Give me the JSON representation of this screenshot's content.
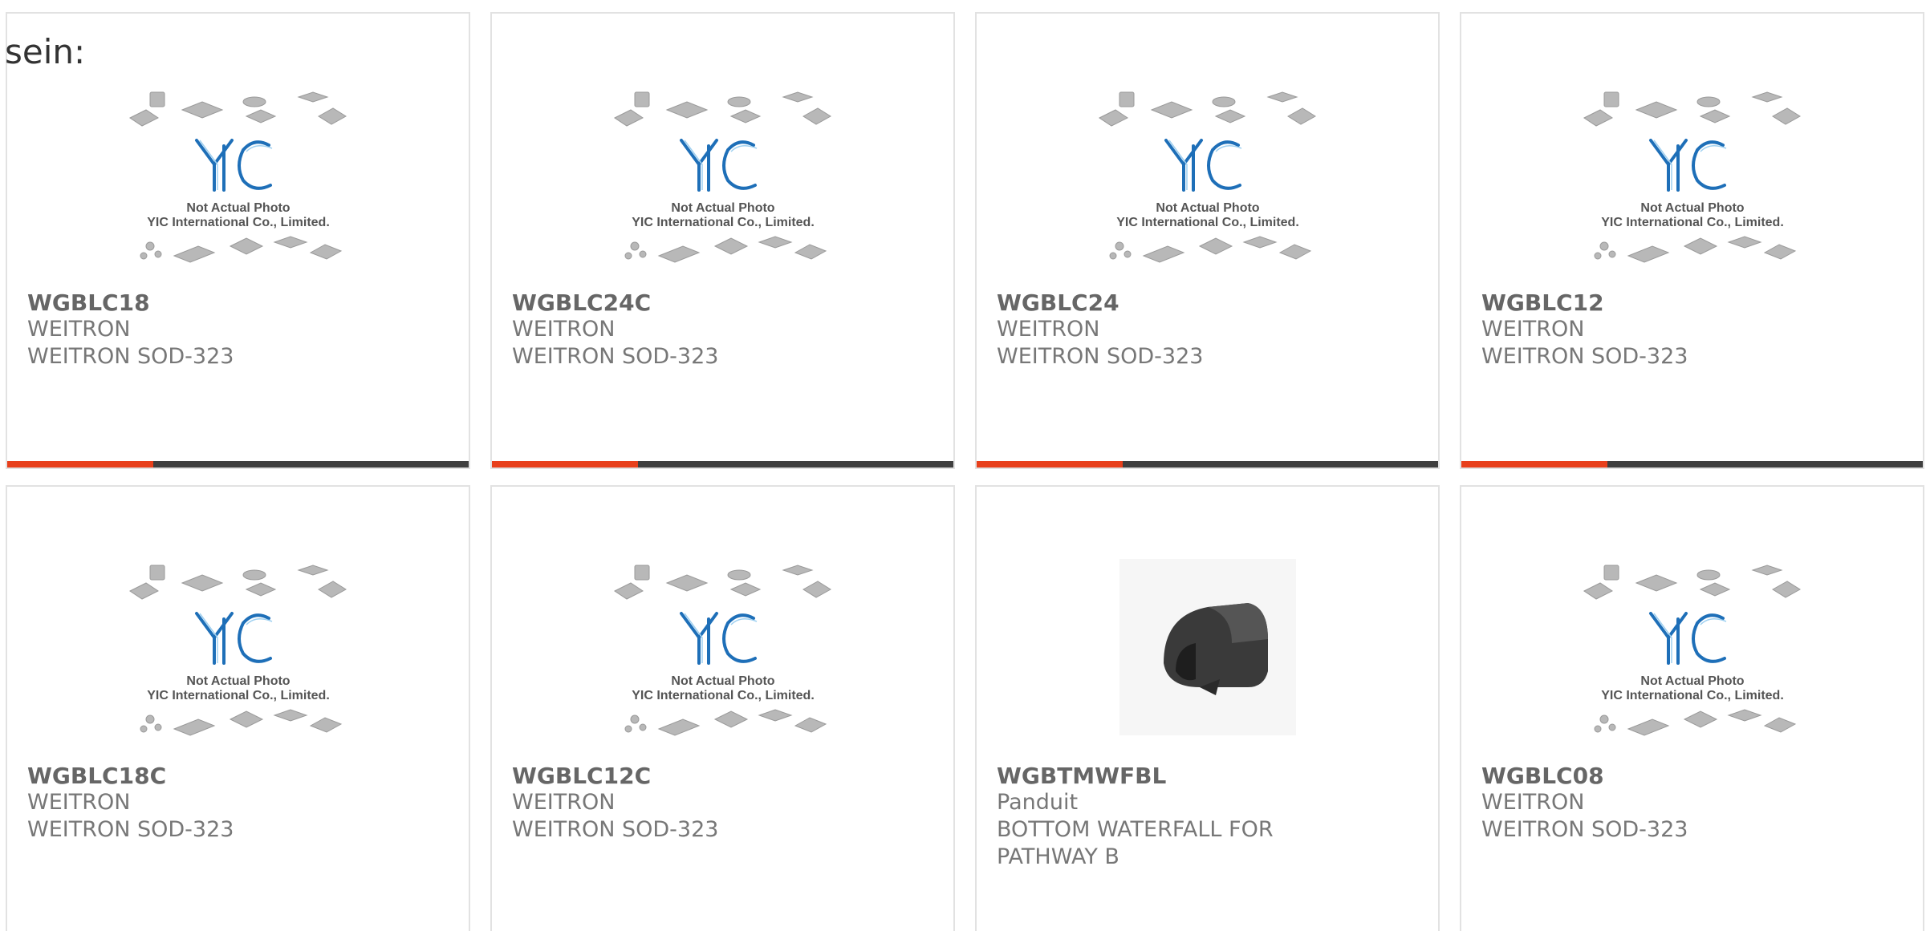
{
  "intro_text": "sein:",
  "placeholder": {
    "line1": "Not Actual Photo",
    "line2": "YIC International Co., Limited.",
    "logo": "YIC"
  },
  "products": [
    {
      "part": "WGBLC18",
      "maker": "WEITRON",
      "desc": "WEITRON SOD-323",
      "image": "placeholder"
    },
    {
      "part": "WGBLC24C",
      "maker": "WEITRON",
      "desc": "WEITRON SOD-323",
      "image": "placeholder"
    },
    {
      "part": "WGBLC24",
      "maker": "WEITRON",
      "desc": "WEITRON SOD-323",
      "image": "placeholder"
    },
    {
      "part": "WGBLC12",
      "maker": "WEITRON",
      "desc": "WEITRON SOD-323",
      "image": "placeholder"
    },
    {
      "part": "WGBLC18C",
      "maker": "WEITRON",
      "desc": "WEITRON SOD-323",
      "image": "placeholder"
    },
    {
      "part": "WGBLC12C",
      "maker": "WEITRON",
      "desc": "WEITRON SOD-323",
      "image": "placeholder"
    },
    {
      "part": "WGBTMWFBL",
      "maker": "Panduit",
      "desc": "BOTTOM WATERFALL FOR PATHWAY B",
      "image": "photo"
    },
    {
      "part": "WGBLC08",
      "maker": "WEITRON",
      "desc": "WEITRON SOD-323",
      "image": "placeholder"
    }
  ],
  "colors": {
    "accent": "#e8401c",
    "bar": "#3f3f3f",
    "logo_blue": "#1e6fb8"
  }
}
